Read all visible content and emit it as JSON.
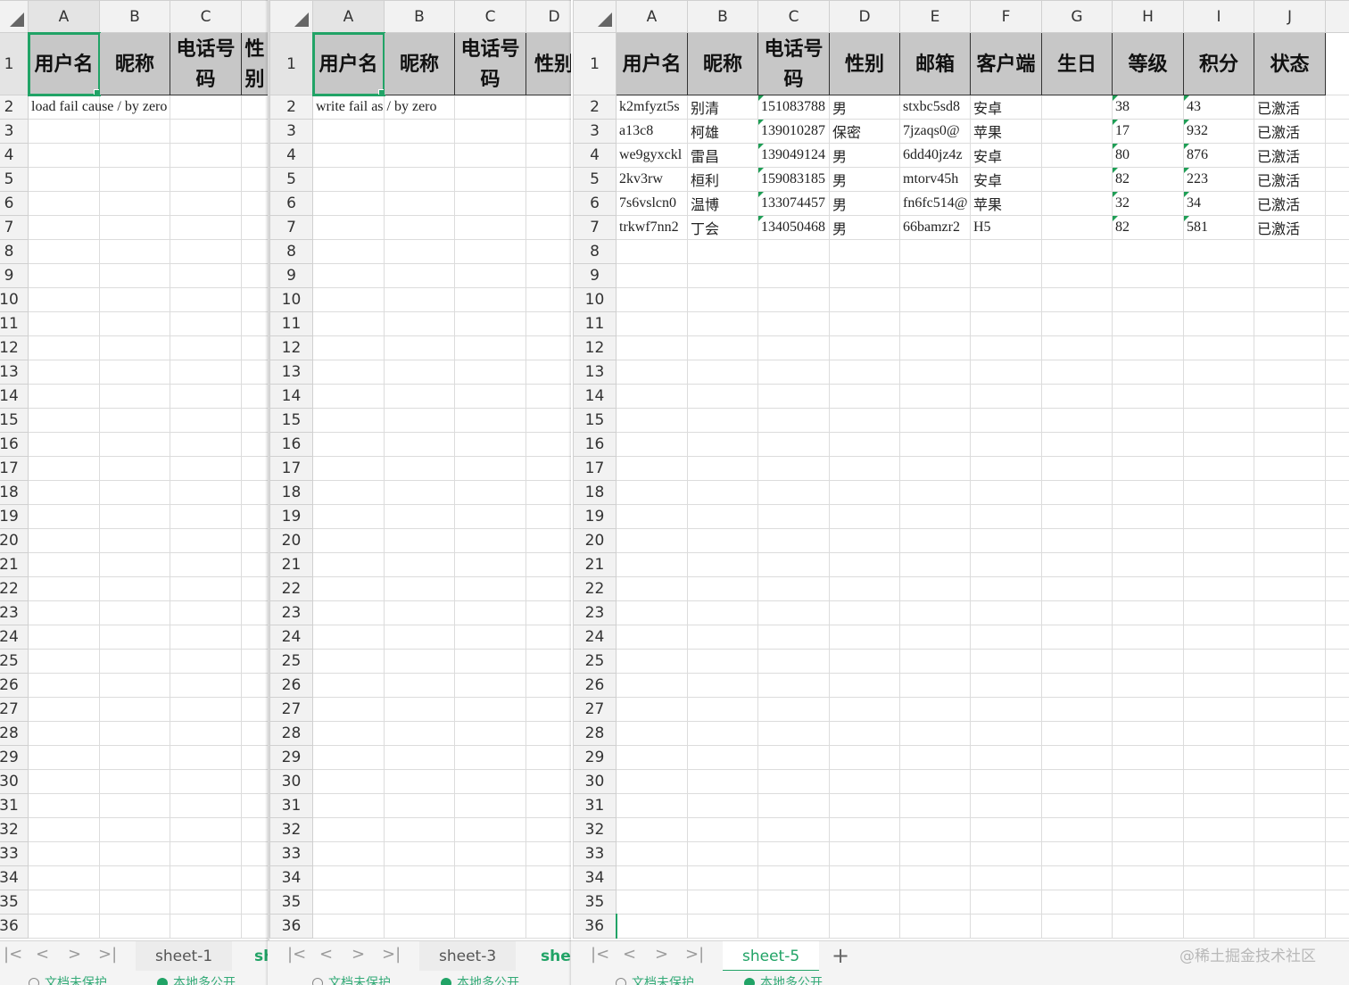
{
  "panels": [
    {
      "columns": [
        "A",
        "B",
        "C"
      ],
      "header": [
        "用户名",
        "昵称",
        "电话号码",
        "性别"
      ],
      "row2": "load fail cause / by zero",
      "tabs": [
        "sheet-1",
        "sh"
      ],
      "status": [
        "文档未保护",
        "本地多公开"
      ]
    },
    {
      "columns": [
        "A",
        "B",
        "C",
        "D"
      ],
      "header": [
        "用户名",
        "昵称",
        "电话号码",
        "性别"
      ],
      "row2": "write fail as / by zero",
      "tabs": [
        "sheet-3",
        "shee"
      ],
      "status": [
        "文档未保护",
        "本地多公开"
      ]
    },
    {
      "columns": [
        "A",
        "B",
        "C",
        "D",
        "E",
        "F",
        "G",
        "H",
        "I",
        "J"
      ],
      "header": [
        "用户名",
        "昵称",
        "电话号码",
        "性别",
        "邮箱",
        "客户端",
        "生日",
        "等级",
        "积分",
        "状态"
      ],
      "rows": [
        [
          "k2mfyzt5s",
          "别清",
          "151083788",
          "男",
          "stxbc5sd8",
          "安卓",
          "",
          "38",
          "43",
          "已激活"
        ],
        [
          "a13c8",
          "柯雄",
          "139010287",
          "保密",
          "7jzaqs0@",
          "苹果",
          "",
          "17",
          "932",
          "已激活"
        ],
        [
          "we9gyxckl",
          "雷昌",
          "139049124",
          "男",
          "6dd40jz4z",
          "安卓",
          "",
          "80",
          "876",
          "已激活"
        ],
        [
          "2kv3rw",
          "桓利",
          "159083185",
          "男",
          "mtorv45h",
          "安卓",
          "",
          "82",
          "223",
          "已激活"
        ],
        [
          "7s6vslcn0",
          "温博",
          "133074457",
          "男",
          "fn6fc514@",
          "苹果",
          "",
          "32",
          "34",
          "已激活"
        ],
        [
          "trkwf7nn2",
          "丁会",
          "134050468",
          "男",
          "66bamzr2",
          "H5",
          "",
          "82",
          "581",
          "已激活"
        ]
      ],
      "tabs": [
        "sheet-5"
      ],
      "add_tab": "+",
      "status": [
        "文档未保护",
        "本地多公开"
      ]
    }
  ],
  "nav_icons": [
    "first-sheet-icon",
    "prev-sheet-icon",
    "next-sheet-icon",
    "last-sheet-icon"
  ],
  "watermark": "@稀土掘金技术社区",
  "row_count": 36,
  "accent": "#21a366"
}
